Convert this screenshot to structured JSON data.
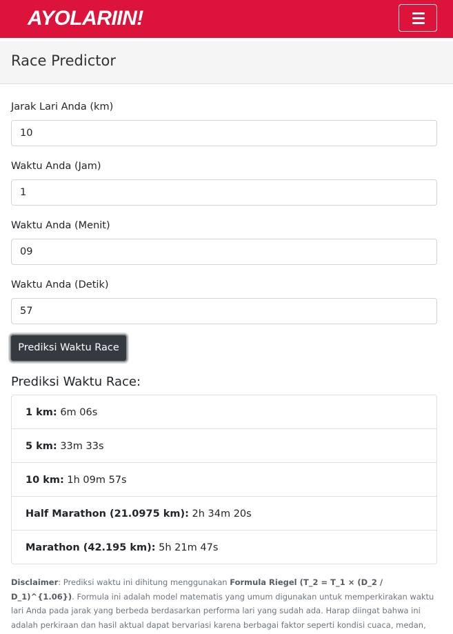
{
  "navbar": {
    "brand": "AYOLARIIN!",
    "menu_icon": "hamburger-menu-icon"
  },
  "page": {
    "title": "Race Predictor"
  },
  "form": {
    "distance": {
      "label": "Jarak Lari Anda (km)",
      "value": "10"
    },
    "hours": {
      "label": "Waktu Anda (Jam)",
      "value": "1"
    },
    "minutes": {
      "label": "Waktu Anda (Menit)",
      "value": "09"
    },
    "seconds": {
      "label": "Waktu Anda (Detik)",
      "value": "57"
    },
    "submit_label": "Prediksi Waktu Race"
  },
  "results": {
    "title": "Prediksi Waktu Race:",
    "items": [
      {
        "label": "1 km:",
        "time": "6m 06s"
      },
      {
        "label": "5 km:",
        "time": "33m 33s"
      },
      {
        "label": "10 km:",
        "time": "1h 09m 57s"
      },
      {
        "label": "Half Marathon (21.0975 km):",
        "time": "2h 34m 20s"
      },
      {
        "label": "Marathon (42.195 km):",
        "time": "5h 21m 47s"
      }
    ]
  },
  "disclaimer": {
    "lead": "Disclaimer",
    "text_1": ": Prediksi waktu ini dihitung menggunakan ",
    "formula_label": "Formula Riegel (T_2 = T_1 × (D_2 / D_1)^{1.06})",
    "text_2": ". Formula ini adalah model matematis yang umum digunakan untuk memperkirakan waktu lari Anda pada jarak yang berbeda berdasarkan performa lari yang sudah ada. Harap diingat bahwa ini adalah perkiraan dan hasil aktual dapat bervariasi karena berbagai faktor seperti kondisi cuaca, medan, tingkat kelelahan, dan strategi balapan."
  },
  "colors": {
    "brand_red": "#dc143c",
    "button_dark": "#343a40"
  }
}
